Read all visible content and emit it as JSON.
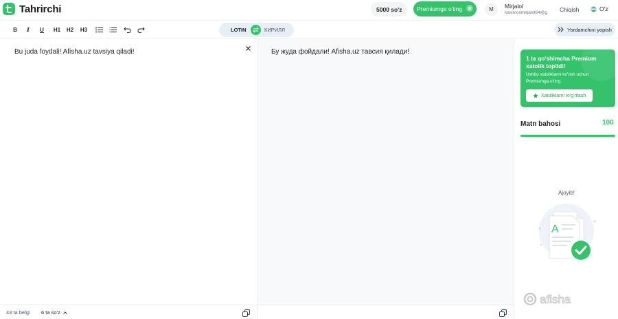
{
  "brand": {
    "name": "Tahrirchi",
    "accent": "#34c36b"
  },
  "header": {
    "words_badge": "5000 so'z",
    "premium_button": "Premiumga o'ting",
    "avatar_initial": "M",
    "user_name": "Mirjalol",
    "user_email": "kasimovmirjalol64@g",
    "logout": "Chiqish",
    "language": "O'z"
  },
  "toolbar": {
    "bold": "B",
    "italic": "I",
    "underline": "U",
    "h1": "H1",
    "h2": "H2",
    "h3": "H3",
    "script_left": "LOTIN",
    "script_right": "КИРИЛЛ",
    "hide_assistant": "Yordamchini yopish"
  },
  "editor": {
    "input_text": "Bu juda foydali! Afisha.uz tavsiya qiladi!",
    "output_text": "Бу жуда фойдали! Afisha.uz тавсия қилади!",
    "char_count": "43 ta belgi",
    "word_count": "6 ta so'z"
  },
  "sidebar": {
    "premium_card": {
      "title": "1 ta qo'shimcha Premium xatolik topildi!",
      "description": "Ushbu xatoliklarni ko'rish uchun Premiumga o'ting.",
      "button": "Xatoliklarni to'g'rilash"
    },
    "score_label": "Matn bahosi",
    "score_value": "100",
    "score_percent": 100,
    "great": "Ajoyib!"
  },
  "watermark": "afisha"
}
